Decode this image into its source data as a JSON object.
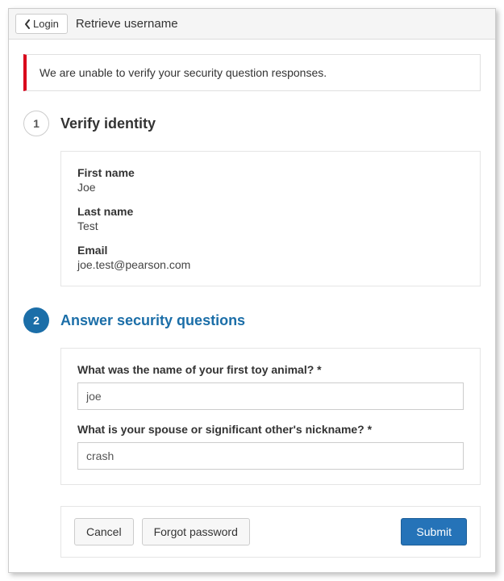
{
  "header": {
    "back_label": "Login",
    "page_title": "Retrieve username"
  },
  "alert": {
    "message": "We are unable to verify your security question responses."
  },
  "steps": {
    "verify": {
      "number": "1",
      "title": "Verify identity",
      "fields": {
        "first_name_label": "First name",
        "first_name_value": "Joe",
        "last_name_label": "Last name",
        "last_name_value": "Test",
        "email_label": "Email",
        "email_value": "joe.test@pearson.com"
      }
    },
    "security": {
      "number": "2",
      "title": "Answer security questions",
      "q1_label": "What was the name of your first toy animal? *",
      "q1_value": "joe",
      "q2_label": "What is your spouse or significant other's nickname? *",
      "q2_value": "crash"
    }
  },
  "actions": {
    "cancel": "Cancel",
    "forgot": "Forgot password",
    "submit": "Submit"
  }
}
